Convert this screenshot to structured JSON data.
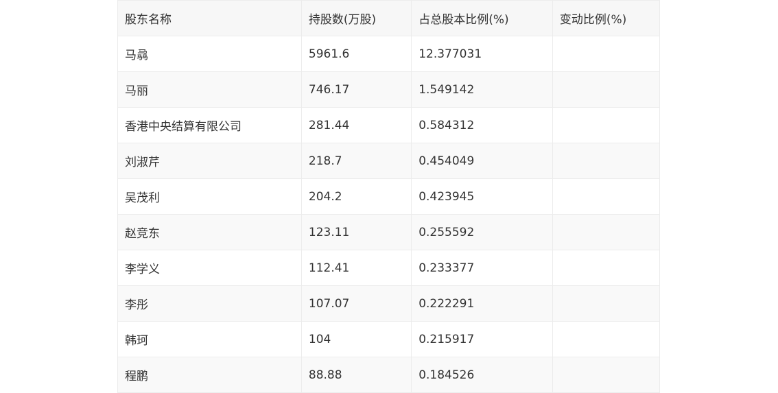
{
  "table": {
    "headers": [
      "股东名称",
      "持股数(万股)",
      "占总股本比例(%)",
      "变动比例(%)"
    ],
    "rows": [
      [
        "马骉",
        "5961.6",
        "12.377031",
        ""
      ],
      [
        "马丽",
        "746.17",
        "1.549142",
        ""
      ],
      [
        "香港中央结算有限公司",
        "281.44",
        "0.584312",
        ""
      ],
      [
        "刘淑芹",
        "218.7",
        "0.454049",
        ""
      ],
      [
        "吴茂利",
        "204.2",
        "0.423945",
        ""
      ],
      [
        "赵竞东",
        "123.11",
        "0.255592",
        ""
      ],
      [
        "李学义",
        "112.41",
        "0.233377",
        ""
      ],
      [
        "李彤",
        "107.07",
        "0.222291",
        ""
      ],
      [
        "韩珂",
        "104",
        "0.215917",
        ""
      ],
      [
        "程鹏",
        "88.88",
        "0.184526",
        ""
      ]
    ]
  }
}
